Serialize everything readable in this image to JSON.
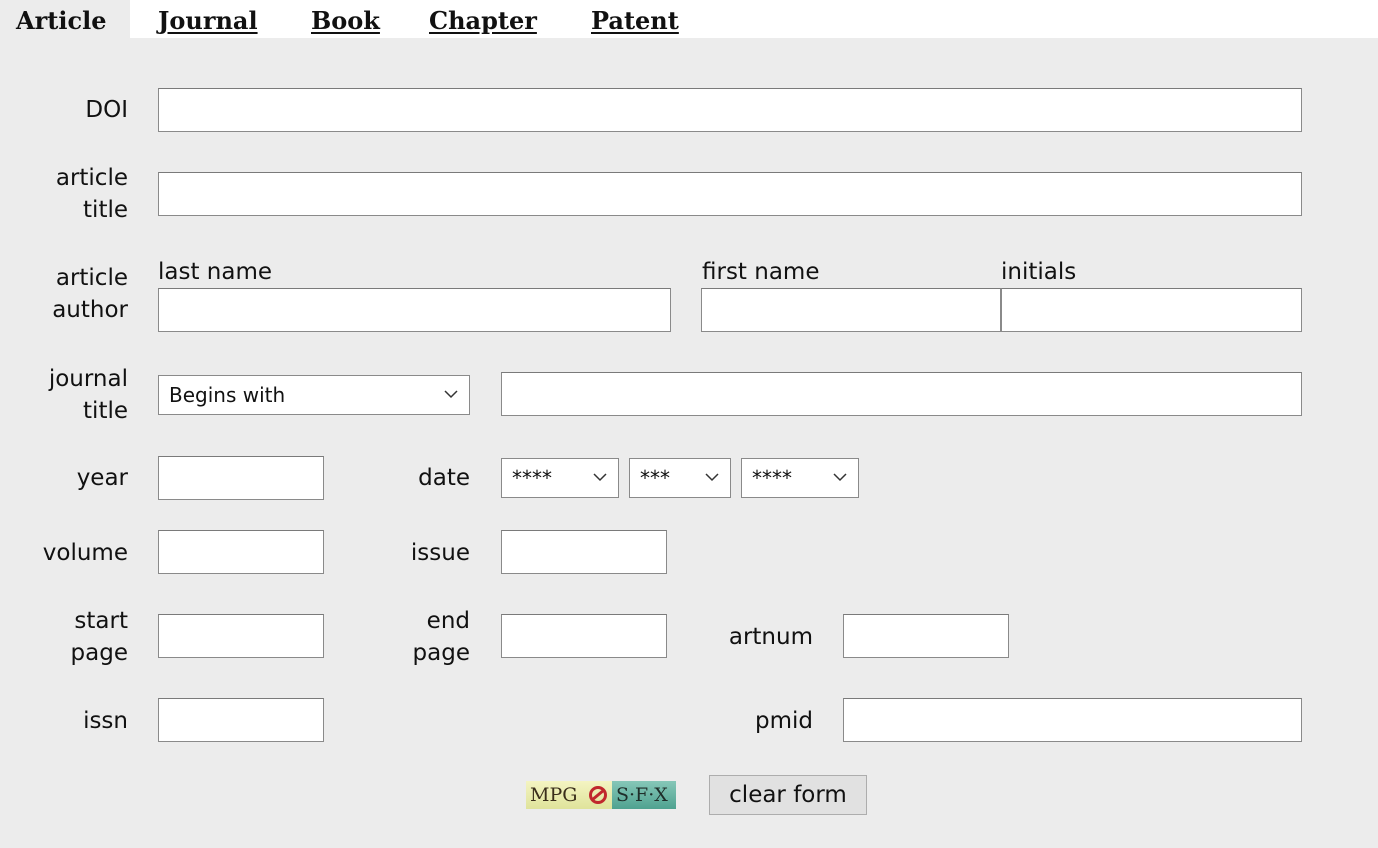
{
  "tabs": [
    {
      "label": "Article",
      "active": true
    },
    {
      "label": "Journal",
      "active": false
    },
    {
      "label": "Book",
      "active": false
    },
    {
      "label": "Chapter",
      "active": false
    },
    {
      "label": "Patent",
      "active": false
    }
  ],
  "labels": {
    "doi": "DOI",
    "article_title_1": "article",
    "article_title_2": "title",
    "article_author_1": "article",
    "article_author_2": "author",
    "last_name": "last name",
    "first_name": "first name",
    "initials": "initials",
    "journal_title_1": "journal",
    "journal_title_2": "title",
    "year": "year",
    "date": "date",
    "volume": "volume",
    "issue": "issue",
    "start_page_1": "start",
    "start_page_2": "page",
    "end_page_1": "end",
    "end_page_2": "page",
    "artnum": "artnum",
    "issn": "issn",
    "pmid": "pmid"
  },
  "fields": {
    "doi": "",
    "article_title": "",
    "last_name": "",
    "first_name": "",
    "initials": "",
    "journal_title": "",
    "year": "",
    "volume": "",
    "issue": "",
    "start_page": "",
    "end_page": "",
    "artnum": "",
    "issn": "",
    "pmid": ""
  },
  "selects": {
    "journal_match": "Begins with",
    "date_year": "****",
    "date_month": "***",
    "date_day": "****"
  },
  "sfx_button": {
    "left_text": "MPG",
    "right_text": "S·F·X"
  },
  "clear_button": "clear form",
  "colors": {
    "panel_bg": "#ececec",
    "sfx_logo": "#c0282d"
  }
}
